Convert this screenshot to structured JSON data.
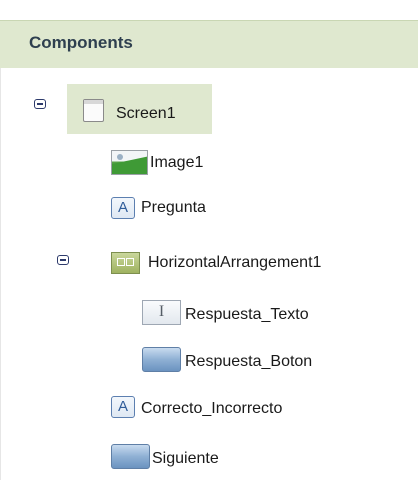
{
  "panel": {
    "title": "Components"
  },
  "tree": {
    "screen": {
      "label": "Screen1",
      "icon": "screen-icon"
    },
    "image1": {
      "label": "Image1",
      "icon": "image-icon"
    },
    "pregunta": {
      "label": "Pregunta",
      "icon": "label-icon",
      "glyph": "A"
    },
    "harr": {
      "label": "HorizontalArrangement1",
      "icon": "horizontal-arrangement-icon"
    },
    "respuesta_texto": {
      "label": "Respuesta_Texto",
      "icon": "textbox-icon",
      "glyph": "I"
    },
    "respuesta_boton": {
      "label": "Respuesta_Boton",
      "icon": "button-icon"
    },
    "correcto": {
      "label": "Correcto_Incorrecto",
      "icon": "label-icon",
      "glyph": "A"
    },
    "siguiente": {
      "label": "Siguiente",
      "icon": "button-icon"
    }
  },
  "colors": {
    "header_bg": "#dfe8cf",
    "selected_bg": "#dfe8cf",
    "title_text": "#2e3f4f"
  }
}
